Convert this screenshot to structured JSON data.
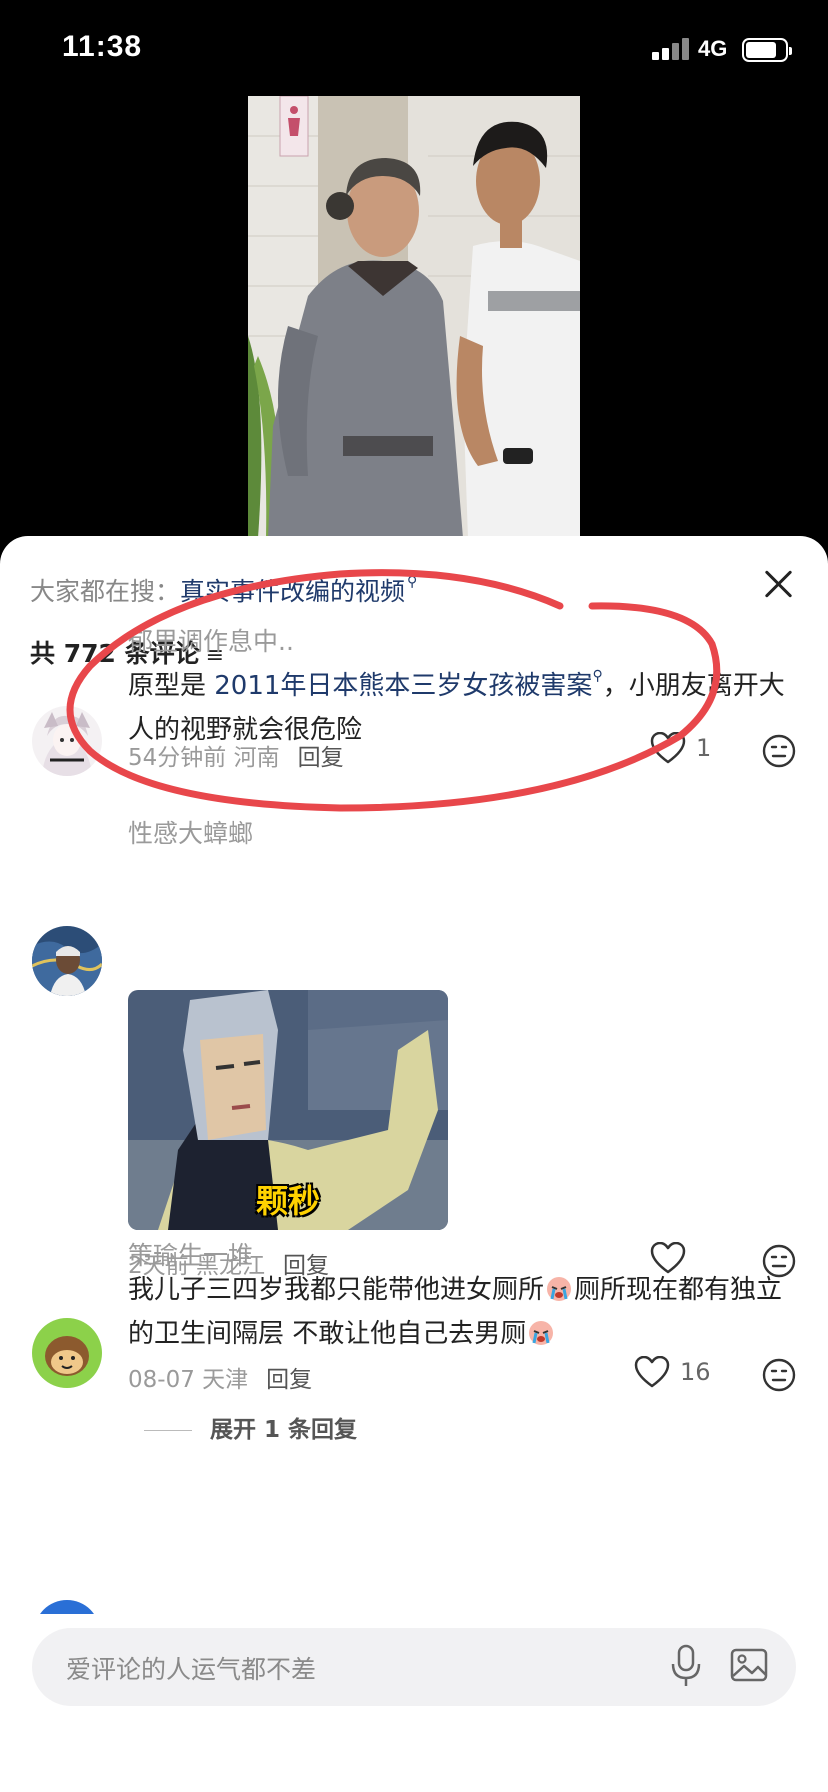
{
  "status_bar": {
    "time": "11:38",
    "network": "4G"
  },
  "sheet": {
    "search_prefix": "大家都在搜：",
    "search_keyword": "真实事件改编的视频",
    "comment_count_label": "共 772 条评论",
    "sort_icon": "filter-icon"
  },
  "comments": [
    {
      "username": "郁里调作息中..",
      "text_before": "原型是 ",
      "text_link": "2011年日本熊本三岁女孩被害案",
      "text_after": "，小朋友离开大人的视野就会很危险",
      "time": "54分钟前",
      "location": "河南",
      "reply": "回复",
      "likes": "1"
    },
    {
      "username": "性感大蟑螂",
      "gif_caption": "颗秒",
      "time": "2天前",
      "location": "黑龙江",
      "reply": "回复",
      "likes": ""
    },
    {
      "username": "策瑜生一堆",
      "text_part1": "我儿子三四岁我都只能带他进女厕所",
      "text_part2": "厕所现在都有独立的卫生间隔层 不敢让他自己去男厕",
      "time": "08-07",
      "location": "天津",
      "reply": "回复",
      "likes": "16",
      "expand_label": "展开 1 条回复"
    }
  ],
  "input": {
    "placeholder": "爱评论的人运气都不差"
  },
  "colors": {
    "link": "#1f3a6b",
    "annotation": "#e8474b"
  }
}
